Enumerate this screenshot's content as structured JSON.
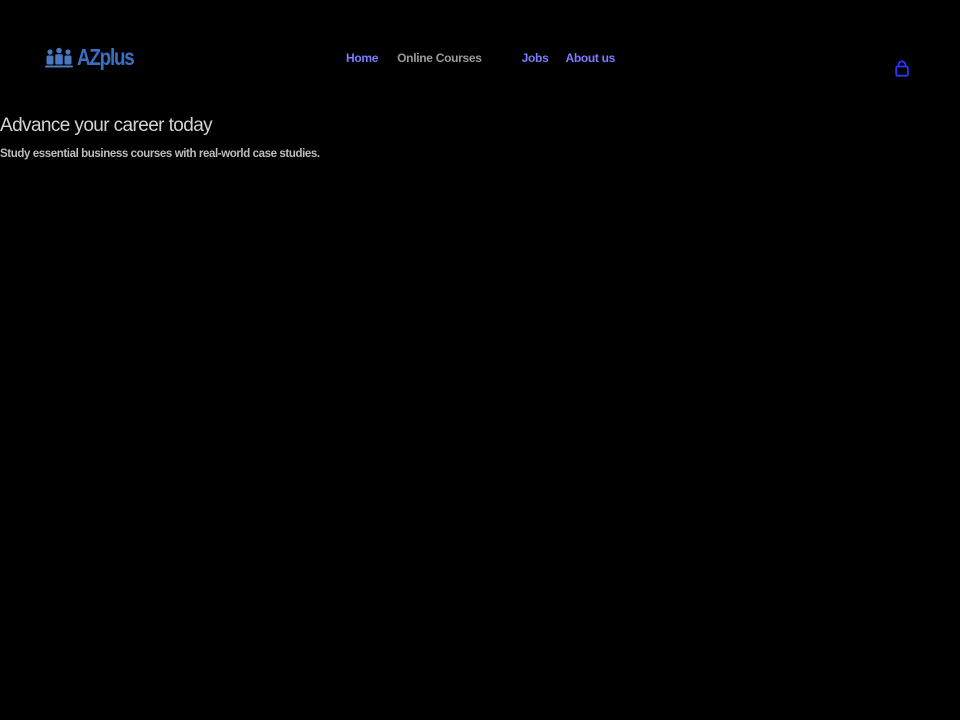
{
  "brand": {
    "name": "AZplus",
    "icon": "people-group-icon"
  },
  "nav": {
    "items": [
      {
        "label": "Home",
        "active": false
      },
      {
        "label": "Online Courses",
        "active": true
      },
      {
        "label": "Jobs",
        "active": false
      },
      {
        "label": "About us",
        "active": false
      }
    ]
  },
  "cart": {
    "icon": "shopping-bag-icon"
  },
  "hero": {
    "title": "Advance your career today",
    "subtitle": "Study essential business courses with real-world case studies."
  },
  "colors": {
    "background": "#000000",
    "logo_text": "#3b6fc4",
    "logo_mark": "#4a78c0",
    "nav_link": "#7b7cff",
    "nav_active": "#9a9a9a",
    "cart_icon": "#2a35ff",
    "hero_title": "#d4d4d4",
    "hero_subtitle": "#bdbdbd"
  }
}
